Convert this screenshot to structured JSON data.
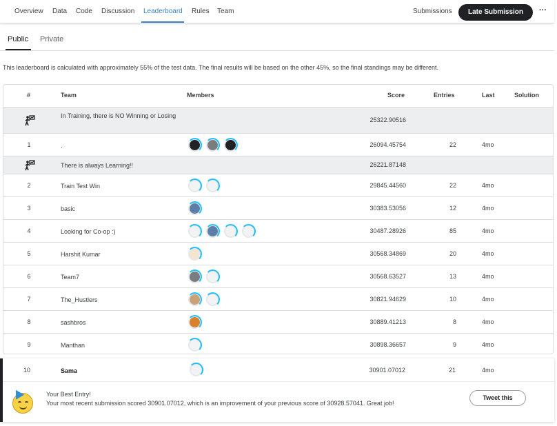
{
  "nav": {
    "tabs": [
      "Overview",
      "Data",
      "Code",
      "Discussion",
      "Leaderboard",
      "Rules",
      "Team"
    ],
    "active_tab": "Leaderboard",
    "submissions_label": "Submissions",
    "late_submission_label": "Late Submission",
    "more_label": "···"
  },
  "subtabs": {
    "public": "Public",
    "private": "Private",
    "active": "Public"
  },
  "note": "This leaderboard is calculated with approximately 55% of the test data. The final results will be based on the other 45%, so the final standings may be different.",
  "table": {
    "headers": {
      "rank": "#",
      "team": "Team",
      "members": "Members",
      "score": "Score",
      "entries": "Entries",
      "last": "Last",
      "solution": "Solution"
    },
    "rows": [
      {
        "type": "benchmark",
        "team": "In Training, there is NO Winning or Losing",
        "score": "25322.90516",
        "members": []
      },
      {
        "type": "team",
        "rank": "1",
        "team": ".",
        "score": "26094.45754",
        "entries": "22",
        "last": "4mo",
        "members": [
          "dark",
          "gray",
          "dark"
        ]
      },
      {
        "type": "benchmark",
        "team": "There is always Learning!!",
        "score": "26221.87148",
        "members": []
      },
      {
        "type": "team",
        "rank": "2",
        "team": "Train Test Win",
        "score": "29845.44560",
        "entries": "22",
        "last": "4mo",
        "members": [
          "light",
          "light"
        ]
      },
      {
        "type": "team",
        "rank": "3",
        "team": "basic",
        "score": "30383.53056",
        "entries": "12",
        "last": "4mo",
        "members": [
          "blue"
        ]
      },
      {
        "type": "team",
        "rank": "4",
        "team": "Looking for Co-op :)",
        "score": "30487.28926",
        "entries": "85",
        "last": "4mo",
        "members": [
          "light",
          "blue",
          "light",
          "light"
        ]
      },
      {
        "type": "team",
        "rank": "5",
        "team": "Harshit Kumar",
        "score": "30568.34869",
        "entries": "20",
        "last": "4mo",
        "members": [
          "beige"
        ]
      },
      {
        "type": "team",
        "rank": "6",
        "team": "Team7",
        "score": "30568.63527",
        "entries": "13",
        "last": "4mo",
        "members": [
          "gray",
          "light"
        ]
      },
      {
        "type": "team",
        "rank": "7",
        "team": "The_Hustlers",
        "score": "30821.94629",
        "entries": "10",
        "last": "4mo",
        "members": [
          "tan",
          "light"
        ]
      },
      {
        "type": "team",
        "rank": "8",
        "team": "sashbros",
        "score": "30889.41213",
        "entries": "8",
        "last": "4mo",
        "members": [
          "orange"
        ]
      },
      {
        "type": "team",
        "rank": "9",
        "team": "Manthan",
        "score": "30898.36657",
        "entries": "9",
        "last": "4mo",
        "members": [
          "light"
        ]
      }
    ]
  },
  "your_entry": {
    "rank": "10",
    "team": "Sama",
    "score": "30901.07012",
    "entries": "21",
    "last": "4mo",
    "members": [
      "light"
    ],
    "best_title": "Your Best Entry!",
    "best_message": "Your most recent submission scored 30901.07012, which is an improvement of your previous score of 30928.57041. Great job!",
    "tweet_label": "Tweet this"
  },
  "colors": {
    "accent": "#3b82c4",
    "dark_button": "#202124",
    "benchmark_row": "#eceef0",
    "avatar_ring": "#20beff"
  },
  "icons": {
    "benchmark": "benchmark-icon",
    "more": "more-icon",
    "celebrate": "celebrate-emoji-icon"
  }
}
